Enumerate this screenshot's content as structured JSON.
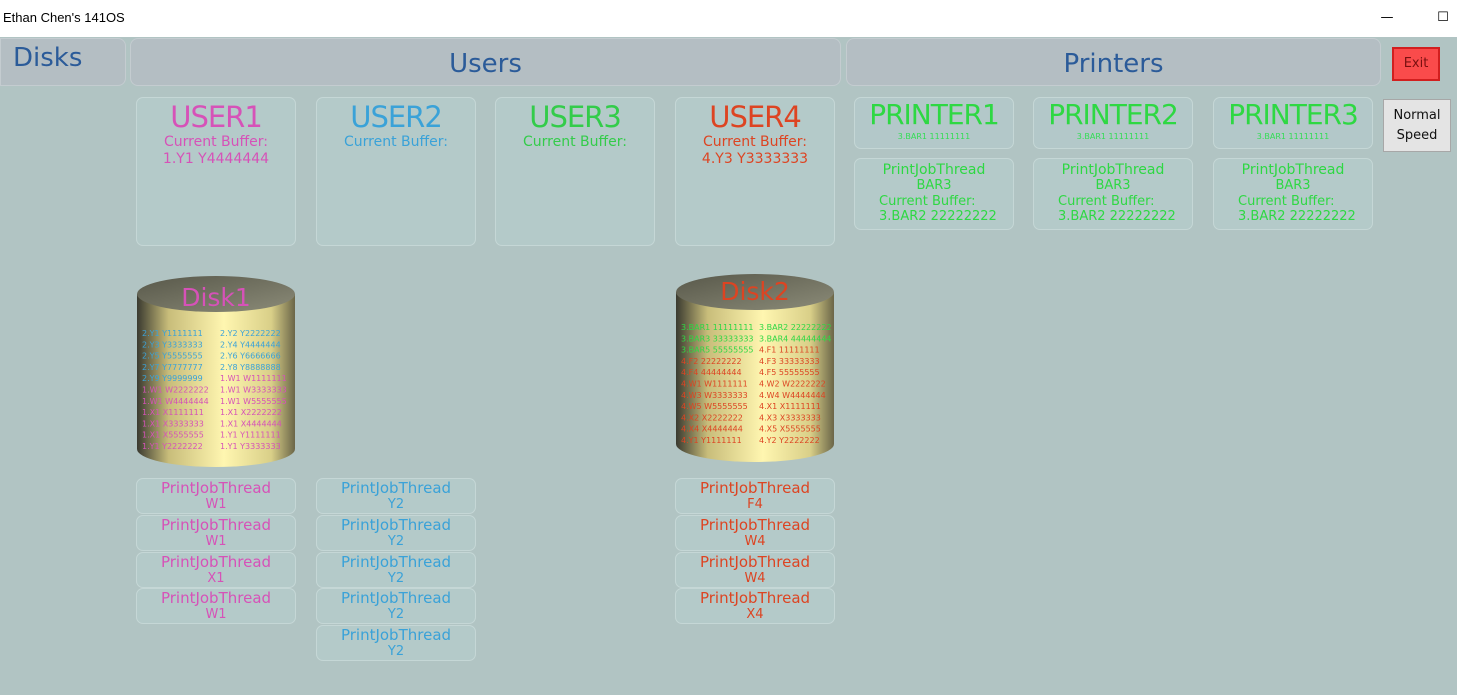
{
  "window": {
    "title": "Ethan Chen's 141OS",
    "minimize": "—",
    "maximize": "☐"
  },
  "headers": {
    "disks": "Disks",
    "users": "Users",
    "printers": "Printers"
  },
  "buttons": {
    "exit": "Exit",
    "speed_line1": "Normal",
    "speed_line2": "Speed"
  },
  "colors": {
    "user1": "#d652b8",
    "user2": "#3aa2d8",
    "user3": "#33cc4a",
    "user4": "#dd4422",
    "printer": "#2ed843",
    "header_text": "#2b5b99"
  },
  "users": [
    {
      "name": "USER1",
      "buffer_label": "Current Buffer:",
      "buffer_value": "1.Y1 Y4444444"
    },
    {
      "name": "USER2",
      "buffer_label": "Current Buffer:",
      "buffer_value": ""
    },
    {
      "name": "USER3",
      "buffer_label": "Current Buffer:",
      "buffer_value": ""
    },
    {
      "name": "USER4",
      "buffer_label": "Current Buffer:",
      "buffer_value": "4.Y3 Y3333333"
    }
  ],
  "printers": [
    {
      "name": "PRINTER1",
      "line": "3.BAR1 11111111",
      "job_label": "PrintJobThread",
      "job_file": "BAR3",
      "buffer_label": "Current Buffer:",
      "buffer_value": "3.BAR2 22222222"
    },
    {
      "name": "PRINTER2",
      "line": "3.BAR1 11111111",
      "job_label": "PrintJobThread",
      "job_file": "BAR3",
      "buffer_label": "Current Buffer:",
      "buffer_value": "3.BAR2 22222222"
    },
    {
      "name": "PRINTER3",
      "line": "3.BAR1 11111111",
      "job_label": "PrintJobThread",
      "job_file": "BAR3",
      "buffer_label": "Current Buffer:",
      "buffer_value": "3.BAR2 22222222"
    }
  ],
  "disks": [
    {
      "name": "Disk1",
      "entries": [
        [
          "2.Y1 Y1111111",
          "2.Y2 Y2222222"
        ],
        [
          "2.Y3 Y3333333",
          "2.Y4 Y4444444"
        ],
        [
          "2.Y5 Y5555555",
          "2.Y6 Y6666666"
        ],
        [
          "2.Y7 Y7777777",
          "2.Y8 Y8888888"
        ],
        [
          "2.Y9 Y9999999",
          "1.W1 W1111111"
        ],
        [
          "1.W1 W2222222",
          "1.W1 W3333333"
        ],
        [
          "1.W1 W4444444",
          "1.W1 W5555555"
        ],
        [
          "1.X1 X1111111",
          "1.X1 X2222222"
        ],
        [
          "1.X1 X3333333",
          "1.X1 X4444444"
        ],
        [
          "1.X1 X5555555",
          "1.Y1 Y1111111"
        ],
        [
          "1.Y1 Y2222222",
          "1.Y1 Y3333333"
        ]
      ]
    },
    {
      "name": "Disk2",
      "entries": [
        [
          "3.BAR1 11111111",
          "3.BAR2 22222222"
        ],
        [
          "3.BAR3 33333333",
          "3.BAR4 44444444"
        ],
        [
          "3.BAR5 55555555",
          "4.F1 11111111"
        ],
        [
          "4.F2 22222222",
          "4.F3 33333333"
        ],
        [
          "4.F4 44444444",
          "4.F5 55555555"
        ],
        [
          "4.W1 W1111111",
          "4.W2 W2222222"
        ],
        [
          "4.W3 W3333333",
          "4.W4 W4444444"
        ],
        [
          "4.W5 W5555555",
          "4.X1 X1111111"
        ],
        [
          "4.X2 X2222222",
          "4.X3 X3333333"
        ],
        [
          "4.X4 X4444444",
          "4.X5 X5555555"
        ],
        [
          "4.Y1 Y1111111",
          "4.Y2 Y2222222"
        ]
      ]
    }
  ],
  "print_jobs": {
    "user1": [
      {
        "label": "PrintJobThread",
        "file": "W1"
      },
      {
        "label": "PrintJobThread",
        "file": "W1"
      },
      {
        "label": "PrintJobThread",
        "file": "X1"
      },
      {
        "label": "PrintJobThread",
        "file": "W1"
      }
    ],
    "user2": [
      {
        "label": "PrintJobThread",
        "file": "Y2"
      },
      {
        "label": "PrintJobThread",
        "file": "Y2"
      },
      {
        "label": "PrintJobThread",
        "file": "Y2"
      },
      {
        "label": "PrintJobThread",
        "file": "Y2"
      },
      {
        "label": "PrintJobThread",
        "file": "Y2"
      }
    ],
    "user4": [
      {
        "label": "PrintJobThread",
        "file": "F4"
      },
      {
        "label": "PrintJobThread",
        "file": "W4"
      },
      {
        "label": "PrintJobThread",
        "file": "W4"
      },
      {
        "label": "PrintJobThread",
        "file": "X4"
      }
    ]
  }
}
